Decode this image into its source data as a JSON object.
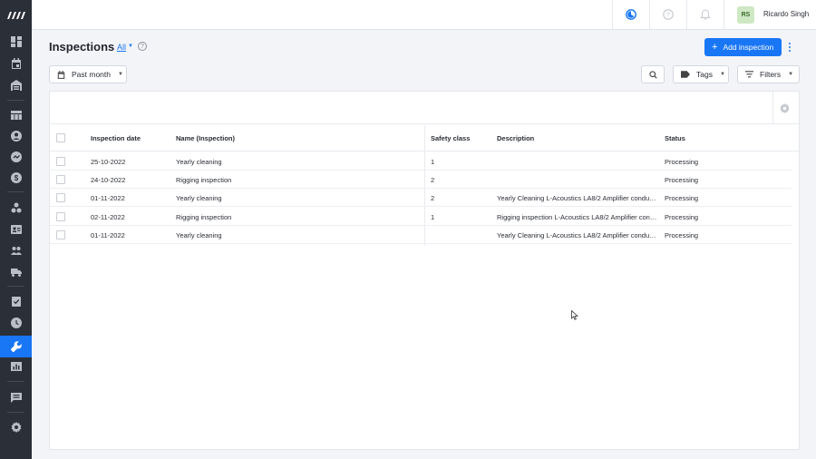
{
  "sidebar": {
    "logo": "brand-logo",
    "items": [
      {
        "icon": "dashboard-icon"
      },
      {
        "icon": "calendar-icon"
      },
      {
        "icon": "warehouse-icon"
      },
      {
        "icon": "planning-table-icon"
      },
      {
        "icon": "contact-icon"
      },
      {
        "icon": "sales-icon"
      },
      {
        "icon": "finance-icon"
      },
      {
        "icon": "inventory-icon"
      },
      {
        "icon": "crew-card-icon"
      },
      {
        "icon": "people-icon"
      },
      {
        "icon": "truck-icon"
      },
      {
        "icon": "tasks-icon"
      },
      {
        "icon": "clock-icon"
      },
      {
        "icon": "wrench-icon",
        "active": true
      },
      {
        "icon": "reports-icon"
      },
      {
        "icon": "messages-icon"
      },
      {
        "icon": "settings-icon"
      }
    ]
  },
  "topbar": {
    "icons": [
      "timer-icon",
      "help-icon",
      "bell-icon"
    ],
    "user": {
      "initials": "RS",
      "name": "Ricardo Singh"
    }
  },
  "header": {
    "title": "Inspections",
    "view": "All",
    "add_button": "Add inspection"
  },
  "filters": {
    "period": "Past month",
    "tags": "Tags",
    "filters": "Filters"
  },
  "table": {
    "columns": [
      "Inspection date",
      "Name (Inspection)",
      "Safety class",
      "Description",
      "Status"
    ],
    "rows": [
      {
        "date": "25-10-2022",
        "name": "Yearly cleaning",
        "safety": "1",
        "description": "",
        "status": "Processing"
      },
      {
        "date": "24-10-2022",
        "name": "Rigging inspection",
        "safety": "2",
        "description": "",
        "status": "Processing"
      },
      {
        "date": "01-11-2022",
        "name": "Yearly cleaning",
        "safety": "2",
        "description": "Yearly Cleaning L-Acoustics LA8/2 Amplifier conducte...",
        "status": "Processing"
      },
      {
        "date": "02-11-2022",
        "name": "Rigging inspection",
        "safety": "1",
        "description": "Rigging inspection L-Acoustics LA8/2 Amplifier condu...",
        "status": "Processing"
      },
      {
        "date": "01-11-2022",
        "name": "Yearly cleaning",
        "safety": "",
        "description": "Yearly Cleaning L-Acoustics LA8/2 Amplifier conducte...",
        "status": "Processing"
      }
    ]
  },
  "colors": {
    "accent": "#1976f5",
    "sidebar": "#2b2f38",
    "background": "#f3f4f8"
  }
}
